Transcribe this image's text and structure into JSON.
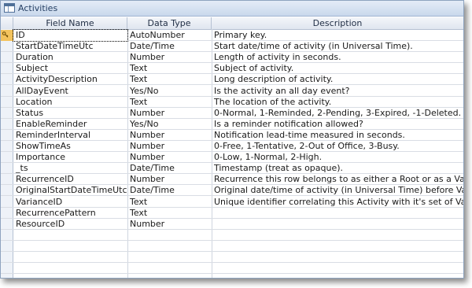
{
  "window": {
    "title": "Activities"
  },
  "columns": [
    "Field Name",
    "Data Type",
    "Description"
  ],
  "rows": [
    {
      "field": "ID",
      "type": "AutoNumber",
      "desc": "Primary key."
    },
    {
      "field": "StartDateTimeUtc",
      "type": "Date/Time",
      "desc": "Start date/time of activity (in Universal Time)."
    },
    {
      "field": "Duration",
      "type": "Number",
      "desc": "Length of activity in seconds."
    },
    {
      "field": "Subject",
      "type": "Text",
      "desc": "Subject of activity."
    },
    {
      "field": "ActivityDescription",
      "type": "Text",
      "desc": "Long description of activity."
    },
    {
      "field": "AllDayEvent",
      "type": "Yes/No",
      "desc": "Is the activity an all day event?"
    },
    {
      "field": "Location",
      "type": "Text",
      "desc": "The location of the activity."
    },
    {
      "field": "Status",
      "type": "Number",
      "desc": "0-Normal, 1-Reminded, 2-Pending, 3-Expired, -1-Deleted."
    },
    {
      "field": "EnableReminder",
      "type": "Yes/No",
      "desc": "Is a reminder notification allowed?"
    },
    {
      "field": "ReminderInterval",
      "type": "Number",
      "desc": "Notification lead-time measured in seconds."
    },
    {
      "field": "ShowTimeAs",
      "type": "Number",
      "desc": "0-Free, 1-Tentative, 2-Out of Office, 3-Busy."
    },
    {
      "field": "Importance",
      "type": "Number",
      "desc": "0-Low, 1-Normal, 2-High."
    },
    {
      "field": "_ts",
      "type": "Date/Time",
      "desc": "Timestamp (treat as opaque)."
    },
    {
      "field": "RecurrenceID",
      "type": "Number",
      "desc": "Recurrence this row belongs to as either a Root or as a Variance."
    },
    {
      "field": "OriginalStartDateTimeUtc",
      "type": "Date/Time",
      "desc": "Original date/time of activity (in Universal Time) before Variance."
    },
    {
      "field": "VarianceID",
      "type": "Text",
      "desc": "Unique identifier correlating this Activity with it's set of Variances."
    },
    {
      "field": "RecurrencePattern",
      "type": "Text",
      "desc": ""
    },
    {
      "field": "ResourceID",
      "type": "Number",
      "desc": ""
    }
  ],
  "icons": {
    "title": "table-icon",
    "primary_key": "key-icon"
  }
}
